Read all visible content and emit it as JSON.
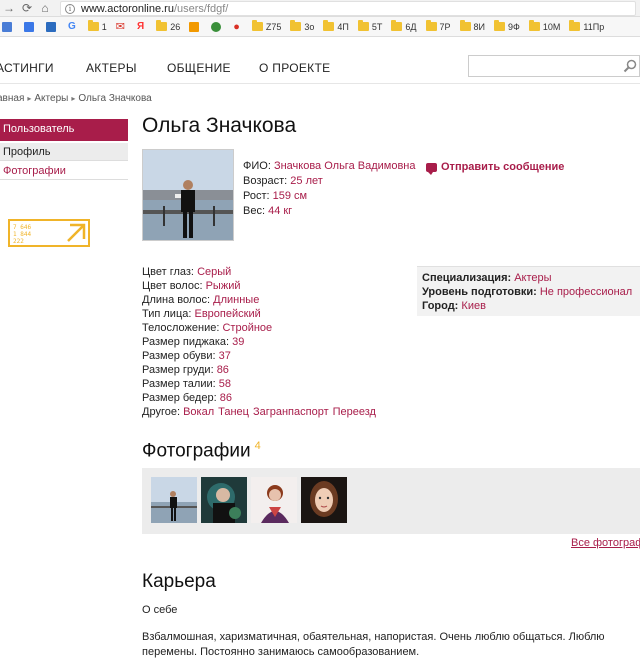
{
  "browser": {
    "url_host": "www.actoronline.ru",
    "url_path": "/users/fdgf/",
    "bookmarks": [
      {
        "label": "1",
        "kind": "folder"
      },
      {
        "label": "",
        "kind": "mail"
      },
      {
        "label": "",
        "kind": "yandex"
      },
      {
        "label": "26",
        "kind": "folder"
      },
      {
        "label": "",
        "kind": "music"
      },
      {
        "label": "",
        "kind": "icon"
      },
      {
        "label": "",
        "kind": "pin"
      },
      {
        "label": "Z75",
        "kind": "folder"
      },
      {
        "label": "3о",
        "kind": "folder"
      },
      {
        "label": "4П",
        "kind": "folder"
      },
      {
        "label": "5T",
        "kind": "folder"
      },
      {
        "label": "6Д",
        "kind": "folder"
      },
      {
        "label": "7Р",
        "kind": "folder"
      },
      {
        "label": "8И",
        "kind": "folder"
      },
      {
        "label": "9Ф",
        "kind": "folder"
      },
      {
        "label": "10М",
        "kind": "folder"
      },
      {
        "label": "11Пр",
        "kind": "folder"
      }
    ]
  },
  "nav": {
    "items": [
      "АСТИНГИ",
      "АКТЕРЫ",
      "ОБЩЕНИЕ",
      "О ПРОЕКТЕ"
    ]
  },
  "breadcrumb": {
    "home": "авная",
    "section": "Актеры",
    "current": "Ольга Значкова"
  },
  "sidebar": {
    "header": "Пользователь",
    "items": [
      {
        "label": "Профиль"
      },
      {
        "label": "Фотографии"
      }
    ],
    "counter_lines": [
      "7 646",
      "1 844",
      "222"
    ]
  },
  "profile": {
    "title": "Ольга Значкова",
    "fio_label": "ФИО:",
    "fio_value": "Значкова Ольга Вадимовна",
    "age_label": "Возраст:",
    "age_value": "25 лет",
    "height_label": "Рост:",
    "height_value": "159 см",
    "weight_label": "Вес:",
    "weight_value": "44 кг",
    "send_message": "Отправить сообщение"
  },
  "params": {
    "eye_label": "Цвет глаз:",
    "eye_value": "Серый",
    "hair_label": "Цвет волос:",
    "hair_value": "Рыжий",
    "hairlen_label": "Длина волос:",
    "hairlen_value": "Длинные",
    "face_label": "Тип лица:",
    "face_value": "Европейский",
    "body_label": "Телосложение:",
    "body_value": "Стройное",
    "jacket_label": "Размер пиджака:",
    "jacket_value": "39",
    "shoe_label": "Размер обуви:",
    "shoe_value": "37",
    "chest_label": "Размер груди:",
    "chest_value": "86",
    "waist_label": "Размер талии:",
    "waist_value": "58",
    "hips_label": "Размер бедер:",
    "hips_value": "86",
    "other_label": "Другое:",
    "other_values": [
      "Вокал",
      "Танец",
      "Загранпаспорт",
      "Переезд"
    ]
  },
  "spec": {
    "spec_label": "Специализация:",
    "spec_value": "Актеры",
    "level_label": "Уровень подготовки:",
    "level_value": "Не профессионал",
    "city_label": "Город:",
    "city_value": "Киев"
  },
  "photos": {
    "title": "Фотографии",
    "count": "4",
    "all_link": "Все фотограф"
  },
  "career": {
    "title": "Карьера",
    "about_label": "О себе",
    "about_text": "Взбалмошная, харизматичная, обаятельная, напористая. Очень люблю общаться. Люблю перемены. Постоянно занимаюсь самообразованием."
  },
  "colors": {
    "accent": "#a81d4a",
    "badge": "#f0b429"
  }
}
